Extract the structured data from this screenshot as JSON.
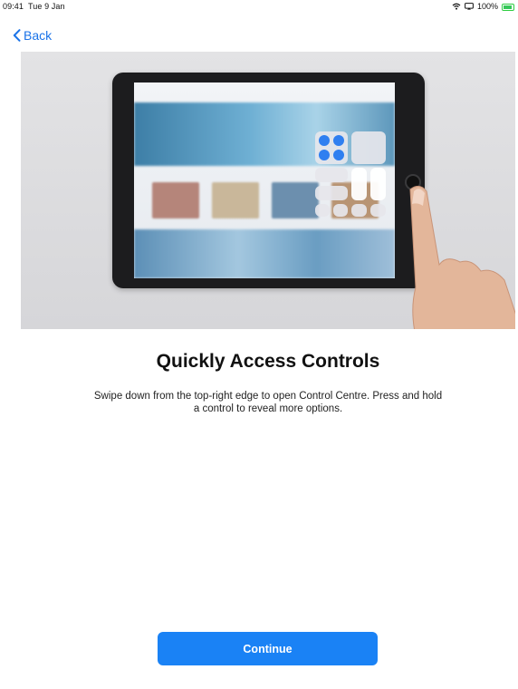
{
  "status_bar": {
    "time": "09:41",
    "date": "Tue 9 Jan",
    "battery": "100%"
  },
  "nav": {
    "back_label": "Back",
    "back_icon": "chevron-left-icon"
  },
  "hero": {
    "image": "ipad-control-centre-illustration"
  },
  "content": {
    "title": "Quickly Access Controls",
    "description": "Swipe down from the top-right edge to open Control Centre. Press and hold a control to reveal more options."
  },
  "actions": {
    "continue_label": "Continue"
  },
  "colors": {
    "accent": "#1a82f5",
    "link": "#1a73e8",
    "battery": "#35c759"
  }
}
